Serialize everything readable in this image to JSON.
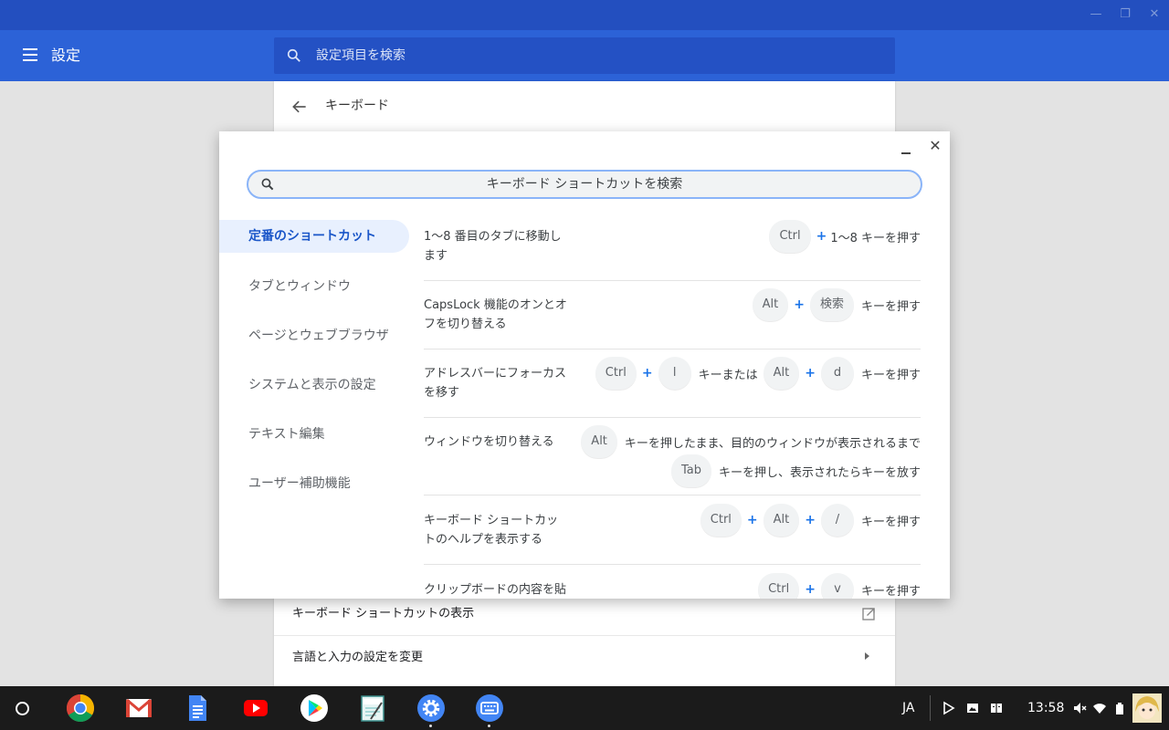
{
  "window": {
    "controls": [
      "—",
      "❐",
      "✕"
    ]
  },
  "header": {
    "title": "設定",
    "search_placeholder": "設定項目を検索"
  },
  "card": {
    "back_icon": "arrow-back-icon",
    "title": "キーボード",
    "rows": [
      {
        "label": "キーボード ショートカットの表示",
        "icon": "open-external-icon"
      },
      {
        "label": "言語と入力の設定を変更",
        "icon": "arrow-right-icon"
      }
    ]
  },
  "dialog": {
    "search_placeholder": "キーボード ショートカットを検索",
    "nav": [
      {
        "label": "定番のショートカット",
        "active": true
      },
      {
        "label": "タブとウィンドウ"
      },
      {
        "label": "ページとウェブブラウザ"
      },
      {
        "label": "システムと表示の設定"
      },
      {
        "label": "テキスト編集"
      },
      {
        "label": "ユーザー補助機能"
      }
    ],
    "shortcuts": [
      {
        "desc": [
          "1〜8 番目のタブに移動し",
          "ます"
        ],
        "line1": [
          "Ctrl",
          "+",
          "1〜8 キーを押す"
        ]
      },
      {
        "desc": [
          "CapsLock 機能のオンとオ",
          "フを切り替える"
        ],
        "line1": [
          "Alt",
          "+",
          "検索",
          "キーを押す"
        ]
      },
      {
        "desc": [
          "アドレスバーにフォーカス",
          "を移す"
        ],
        "line1": [
          "Ctrl",
          "+",
          "l",
          "キーまたは",
          "Alt",
          "+",
          "d",
          "キーを押す"
        ]
      },
      {
        "desc": [
          "ウィンドウを切り替える"
        ],
        "line1": [
          "Alt",
          "キーを押したまま、目的のウィンドウが表示されるまで"
        ],
        "line2": [
          "Tab",
          "キーを押し、表示されたらキーを放す"
        ]
      },
      {
        "desc": [
          "キーボード ショートカッ",
          "トのヘルプを表示する"
        ],
        "line1": [
          "Ctrl",
          "+",
          "Alt",
          "+",
          "/",
          "キーを押す"
        ]
      },
      {
        "desc": [
          "クリップボードの内容を貼"
        ],
        "line1": [
          "Ctrl",
          "+",
          "v",
          "キーを押す"
        ]
      }
    ],
    "key_labels": [
      "Ctrl",
      "Alt",
      "検索",
      "l",
      "d",
      "Tab",
      "/",
      "v"
    ]
  },
  "shelf": {
    "apps": [
      "chrome-icon",
      "gmail-icon",
      "docs-icon",
      "youtube-icon",
      "play-store-icon",
      "jota-text-editor-icon",
      "settings-app-icon",
      "keyboard-shortcuts-app-icon"
    ],
    "ime": "JA",
    "time": "13:58",
    "tray": [
      "play-notification-icon",
      "image-notification-icon",
      "book-notification-icon",
      "volume-muted-icon",
      "wifi-icon",
      "battery-icon",
      "user-avatar"
    ]
  }
}
